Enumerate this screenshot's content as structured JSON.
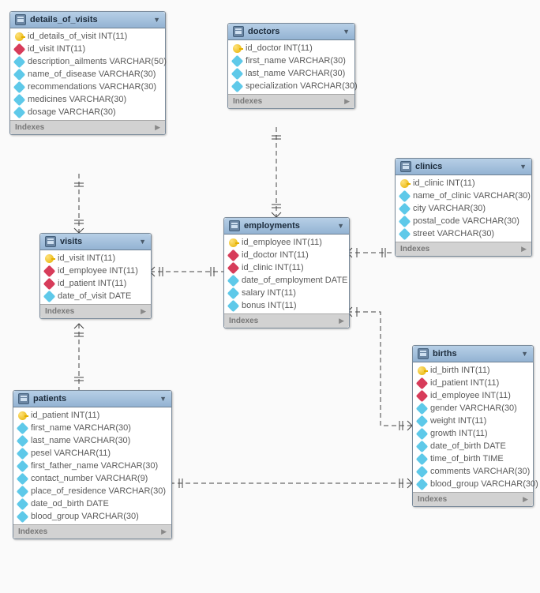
{
  "tables": {
    "details_of_visits": {
      "title": "details_of_visits",
      "columns": [
        {
          "type": "key",
          "label": "id_details_of_visit INT(11)"
        },
        {
          "type": "fk",
          "label": "id_visit INT(11)"
        },
        {
          "type": "fld",
          "label": "description_ailments VARCHAR(50)"
        },
        {
          "type": "fld",
          "label": "name_of_disease VARCHAR(30)"
        },
        {
          "type": "fld",
          "label": "recommendations VARCHAR(30)"
        },
        {
          "type": "fld",
          "label": "medicines VARCHAR(30)"
        },
        {
          "type": "fld",
          "label": "dosage VARCHAR(30)"
        }
      ],
      "footer": "Indexes"
    },
    "doctors": {
      "title": "doctors",
      "columns": [
        {
          "type": "key",
          "label": "id_doctor INT(11)"
        },
        {
          "type": "fld",
          "label": "first_name VARCHAR(30)"
        },
        {
          "type": "fld",
          "label": "last_name VARCHAR(30)"
        },
        {
          "type": "fld",
          "label": "specialization VARCHAR(30)"
        }
      ],
      "footer": "Indexes"
    },
    "clinics": {
      "title": "clinics",
      "columns": [
        {
          "type": "key",
          "label": "id_clinic INT(11)"
        },
        {
          "type": "fld",
          "label": "name_of_clinic VARCHAR(30)"
        },
        {
          "type": "fld",
          "label": "city VARCHAR(30)"
        },
        {
          "type": "fld",
          "label": "postal_code VARCHAR(30)"
        },
        {
          "type": "fld",
          "label": "street VARCHAR(30)"
        }
      ],
      "footer": "Indexes"
    },
    "visits": {
      "title": "visits",
      "columns": [
        {
          "type": "key",
          "label": "id_visit INT(11)"
        },
        {
          "type": "fk",
          "label": "id_employee INT(11)"
        },
        {
          "type": "fk",
          "label": "id_patient INT(11)"
        },
        {
          "type": "fld",
          "label": "date_of_visit DATE"
        }
      ],
      "footer": "Indexes"
    },
    "employments": {
      "title": "employments",
      "columns": [
        {
          "type": "key",
          "label": "id_employee INT(11)"
        },
        {
          "type": "fk",
          "label": "id_doctor INT(11)"
        },
        {
          "type": "fk",
          "label": "id_clinic INT(11)"
        },
        {
          "type": "fld",
          "label": "date_of_employment DATE"
        },
        {
          "type": "fld",
          "label": "salary INT(11)"
        },
        {
          "type": "fld",
          "label": "bonus INT(11)"
        }
      ],
      "footer": "Indexes"
    },
    "births": {
      "title": "births",
      "columns": [
        {
          "type": "key",
          "label": "id_birth INT(11)"
        },
        {
          "type": "fk",
          "label": "id_patient INT(11)"
        },
        {
          "type": "fk",
          "label": "id_employee INT(11)"
        },
        {
          "type": "fld",
          "label": "gender VARCHAR(30)"
        },
        {
          "type": "fld",
          "label": "weight INT(11)"
        },
        {
          "type": "fld",
          "label": "growth INT(11)"
        },
        {
          "type": "fld",
          "label": "date_of_birth DATE"
        },
        {
          "type": "fld",
          "label": "time_of_birth TIME"
        },
        {
          "type": "fld",
          "label": "comments VARCHAR(30)"
        },
        {
          "type": "fld",
          "label": "blood_group VARCHAR(30)"
        }
      ],
      "footer": "Indexes"
    },
    "patients": {
      "title": "patients",
      "columns": [
        {
          "type": "key",
          "label": "id_patient INT(11)"
        },
        {
          "type": "fld",
          "label": "first_name VARCHAR(30)"
        },
        {
          "type": "fld",
          "label": "last_name VARCHAR(30)"
        },
        {
          "type": "fld",
          "label": "pesel VARCHAR(11)"
        },
        {
          "type": "fld",
          "label": "first_father_name VARCHAR(30)"
        },
        {
          "type": "fld",
          "label": "contact_number VARCHAR(9)"
        },
        {
          "type": "fld",
          "label": "place_of_residence VARCHAR(30)"
        },
        {
          "type": "fld",
          "label": "date_od_birth DATE"
        },
        {
          "type": "fld",
          "label": "blood_group VARCHAR(30)"
        }
      ],
      "footer": "Indexes"
    }
  }
}
